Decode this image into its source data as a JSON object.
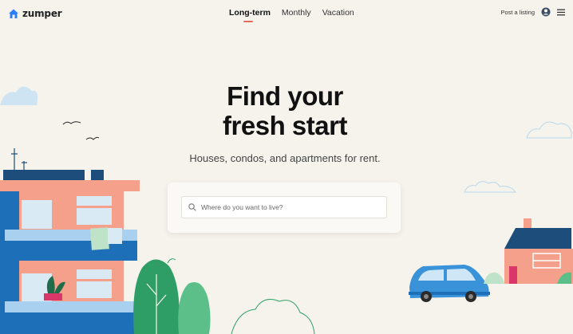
{
  "brand": {
    "name": "zumper",
    "accent": "#2d7ff9"
  },
  "nav": {
    "items": [
      {
        "label": "Long-term",
        "active": true
      },
      {
        "label": "Monthly",
        "active": false
      },
      {
        "label": "Vacation",
        "active": false
      }
    ],
    "underline_color": "#e46a5c"
  },
  "header_actions": {
    "post_listing": "Post a listing",
    "account_icon": "user-circle-icon",
    "menu_icon": "hamburger-menu-icon"
  },
  "hero": {
    "title_line1": "Find your",
    "title_line2": "fresh start",
    "subtitle": "Houses, condos, and apartments for rent."
  },
  "search": {
    "placeholder": "Where do you want to live?",
    "value": "",
    "icon": "search-icon"
  },
  "colors": {
    "background": "#f6f3ec",
    "building_blue": "#1d6fb8",
    "building_salmon": "#f4a08a",
    "car_blue": "#3a93d8",
    "tree_green": "#2e9e66"
  }
}
